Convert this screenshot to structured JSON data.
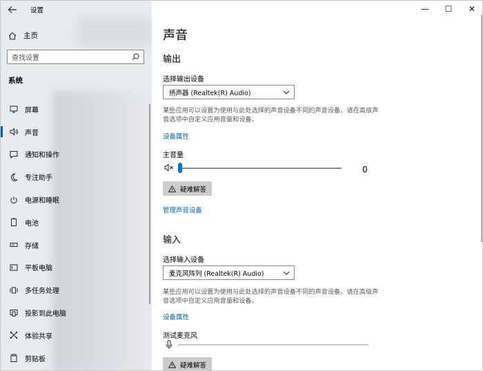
{
  "app": {
    "title": "设置"
  },
  "window_controls": {
    "minimize": "—",
    "maximize": "☐",
    "close": "✕"
  },
  "sidebar": {
    "home": "主页",
    "search_placeholder": "查找设置",
    "section": "系统",
    "items": [
      {
        "label": "屏幕",
        "icon": "monitor-icon"
      },
      {
        "label": "声音",
        "icon": "speaker-icon",
        "active": true
      },
      {
        "label": "通知和操作",
        "icon": "notification-icon"
      },
      {
        "label": "专注助手",
        "icon": "moon-icon"
      },
      {
        "label": "电源和睡眠",
        "icon": "power-icon"
      },
      {
        "label": "电池",
        "icon": "battery-icon"
      },
      {
        "label": "存储",
        "icon": "storage-icon"
      },
      {
        "label": "平板电脑",
        "icon": "tablet-icon"
      },
      {
        "label": "多任务处理",
        "icon": "multitask-icon"
      },
      {
        "label": "投影到此电脑",
        "icon": "project-icon"
      },
      {
        "label": "体验共享",
        "icon": "share-icon"
      },
      {
        "label": "剪贴板",
        "icon": "clipboard-icon"
      }
    ]
  },
  "main": {
    "title": "声音",
    "output": {
      "heading": "输出",
      "device_label": "选择输出设备",
      "device_value": "扬声器 (Realtek(R) Audio)",
      "description": "某些应用可以设置为使用与此处选择的声音设备不同的声音设备。请在高级声音选项中自定义应用音量和设备。",
      "properties_link": "设备属性",
      "volume_label": "主音量",
      "volume_value": "0",
      "volume_level": 0,
      "troubleshoot": "疑难解答",
      "manage_link": "管理声音设备"
    },
    "input": {
      "heading": "输入",
      "device_label": "选择输入设备",
      "device_value": "麦克风阵列 (Realtek(R) Audio)",
      "description": "某些应用可以设置为使用与此处选择的声音设备不同的声音设备。请在高级声音选项中自定义应用音量和设备。",
      "properties_link": "设备属性",
      "test_label": "测试麦克风",
      "troubleshoot": "疑难解答"
    }
  },
  "colors": {
    "accent": "#0078d7",
    "link": "#0067b8"
  }
}
